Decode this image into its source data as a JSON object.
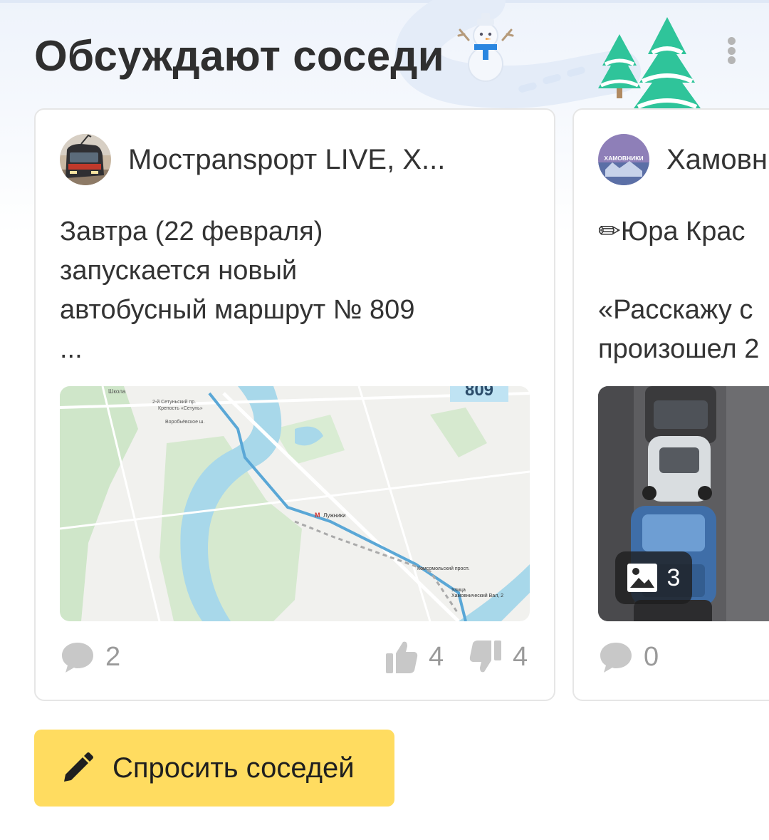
{
  "section": {
    "title": "Обсуждают соседи"
  },
  "colors": {
    "accent_button": "#ffdc60",
    "tree": "#2fc49a",
    "meta_text": "#9a9a9a"
  },
  "cards": [
    {
      "author": "Мострanspорт LIVE, Х...",
      "text": "Завтра (22 февраля)\nзапускается новый\nавтобусный маршрут № 809\n...",
      "media": {
        "type": "map",
        "route_label": "809",
        "map_labels": [
          "Школа",
          "2-й Сетуньский пр.",
          "Крепость «Сетунь»",
          "Воробьёвское ш.",
          "Лужники",
          "Комсомольский просп.",
          "Улица",
          "Хамовнический Вал, 2"
        ]
      },
      "comments": "2",
      "likes": "4",
      "dislikes": "4"
    },
    {
      "author": "Хамовн",
      "avatar_text": "ХАМОВНИКИ",
      "text": "✏Юра Крас\n\n«Расскажу с\nпроизошел 2",
      "media": {
        "type": "photo",
        "photo_count": "3"
      },
      "comments": "0"
    }
  ],
  "actions": {
    "ask_neighbors": "Спросить соседей"
  },
  "icons": [
    "snowman-icon",
    "fir-trees-icon",
    "more-vertical-icon",
    "comment-icon",
    "thumbs-up-icon",
    "thumbs-down-icon",
    "image-icon",
    "pencil-icon"
  ]
}
